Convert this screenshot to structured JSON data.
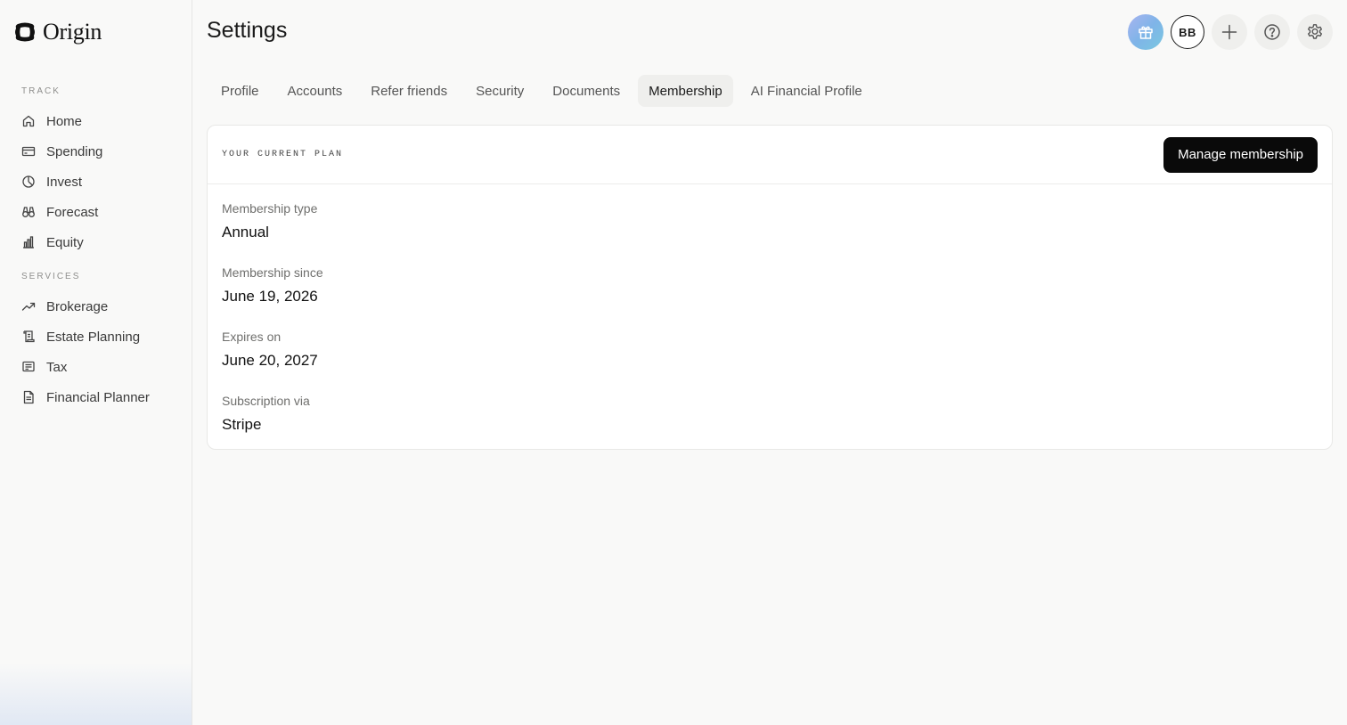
{
  "app": {
    "brand": "Origin"
  },
  "sidebar": {
    "sections": [
      {
        "label": "TRACK",
        "items": [
          {
            "label": "Home",
            "icon": "home-icon"
          },
          {
            "label": "Spending",
            "icon": "credit-card-icon"
          },
          {
            "label": "Invest",
            "icon": "pie-chart-icon"
          },
          {
            "label": "Forecast",
            "icon": "binoculars-icon"
          },
          {
            "label": "Equity",
            "icon": "bar-chart-icon"
          }
        ]
      },
      {
        "label": "SERVICES",
        "items": [
          {
            "label": "Brokerage",
            "icon": "trending-up-icon"
          },
          {
            "label": "Estate Planning",
            "icon": "scroll-icon"
          },
          {
            "label": "Tax",
            "icon": "receipt-icon"
          },
          {
            "label": "Financial Planner",
            "icon": "document-icon"
          }
        ]
      }
    ]
  },
  "header": {
    "title": "Settings",
    "avatar_initials": "BB",
    "actions": [
      "gift-icon",
      "plus-icon",
      "help-icon",
      "gear-icon"
    ]
  },
  "tabs": [
    {
      "label": "Profile",
      "active": false
    },
    {
      "label": "Accounts",
      "active": false
    },
    {
      "label": "Refer friends",
      "active": false
    },
    {
      "label": "Security",
      "active": false
    },
    {
      "label": "Documents",
      "active": false
    },
    {
      "label": "Membership",
      "active": true
    },
    {
      "label": "AI Financial Profile",
      "active": false
    }
  ],
  "plan_card": {
    "header_label": "YOUR CURRENT PLAN",
    "manage_button": "Manage membership",
    "fields": [
      {
        "label": "Membership type",
        "value": "Annual"
      },
      {
        "label": "Membership since",
        "value": "June 19, 2026"
      },
      {
        "label": "Expires on",
        "value": "June 20, 2027"
      },
      {
        "label": "Subscription via",
        "value": "Stripe"
      }
    ]
  },
  "colors": {
    "background": "#f9f9f8",
    "primary_button": "#0a0a0a",
    "active_tab": "#efefed"
  }
}
